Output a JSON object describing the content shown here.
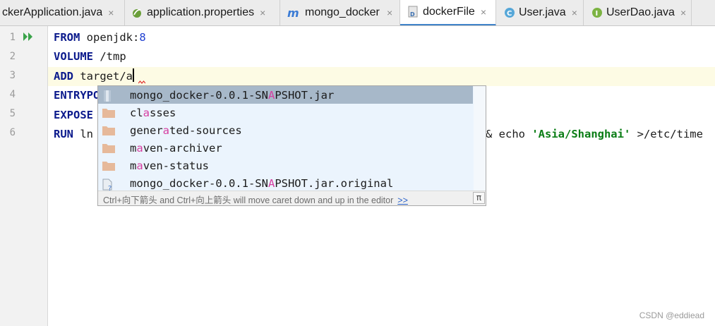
{
  "tabs": [
    {
      "label": "ckerApplication.java",
      "icon": "java-class-icon",
      "active": false
    },
    {
      "label": "application.properties",
      "icon": "spring-properties-icon",
      "active": false
    },
    {
      "label": "mongo_docker",
      "icon": "maven-module-icon",
      "active": false
    },
    {
      "label": "dockerFile",
      "icon": "dockerfile-icon",
      "active": true
    },
    {
      "label": "User.java",
      "icon": "java-class-icon",
      "active": false
    },
    {
      "label": "UserDao.java",
      "icon": "java-interface-icon",
      "active": false
    }
  ],
  "tab_close_glyph": "×",
  "line_numbers": [
    "1",
    "2",
    "3",
    "4",
    "5",
    "6"
  ],
  "code": {
    "line1": {
      "kw": "FROM",
      "text": " openjdk:",
      "num": "8"
    },
    "line2": {
      "kw": "VOLUME",
      "text": " /tmp"
    },
    "line3": {
      "kw": "ADD",
      "text": " target/a"
    },
    "line4": {
      "kw": "ENTRYPO"
    },
    "line5": {
      "kw": "EXPOSE"
    },
    "line6": {
      "kw": "RUN",
      "text_left": " ln",
      "text_right_a": "& echo ",
      "str": "'Asia/Shanghai'",
      "text_right_b": " >/etc/time"
    }
  },
  "completion": {
    "items": [
      {
        "pre": "mongo_docker-0.0.1-SN",
        "hl": "A",
        "post": "PSHOT.jar",
        "icon": "jar-icon",
        "selected": true
      },
      {
        "pre": "cl",
        "hl": "a",
        "post": "sses",
        "icon": "folder-icon",
        "selected": false
      },
      {
        "pre": "gener",
        "hl": "a",
        "post": "ted-sources",
        "icon": "folder-icon",
        "selected": false
      },
      {
        "pre": "m",
        "hl": "a",
        "post": "ven-archiver",
        "icon": "folder-icon",
        "selected": false
      },
      {
        "pre": "m",
        "hl": "a",
        "post": "ven-status",
        "icon": "folder-icon",
        "selected": false
      },
      {
        "pre": "mongo_docker-0.0.1-SN",
        "hl": "A",
        "post": "PSHOT.jar.original",
        "icon": "unknown-file-icon",
        "selected": false
      }
    ],
    "hint": "Ctrl+向下箭头 and Ctrl+向上箭头 will move caret down and up in the editor",
    "hint_link": ">>",
    "pi_glyph": "π"
  },
  "watermark": "CSDN @eddiead",
  "colors": {
    "keyword": "#0b1a8c",
    "string": "#0a7d15",
    "number": "#1f3fd1",
    "match_highlight": "#d63ea1",
    "selection": "#a7b8c9"
  }
}
